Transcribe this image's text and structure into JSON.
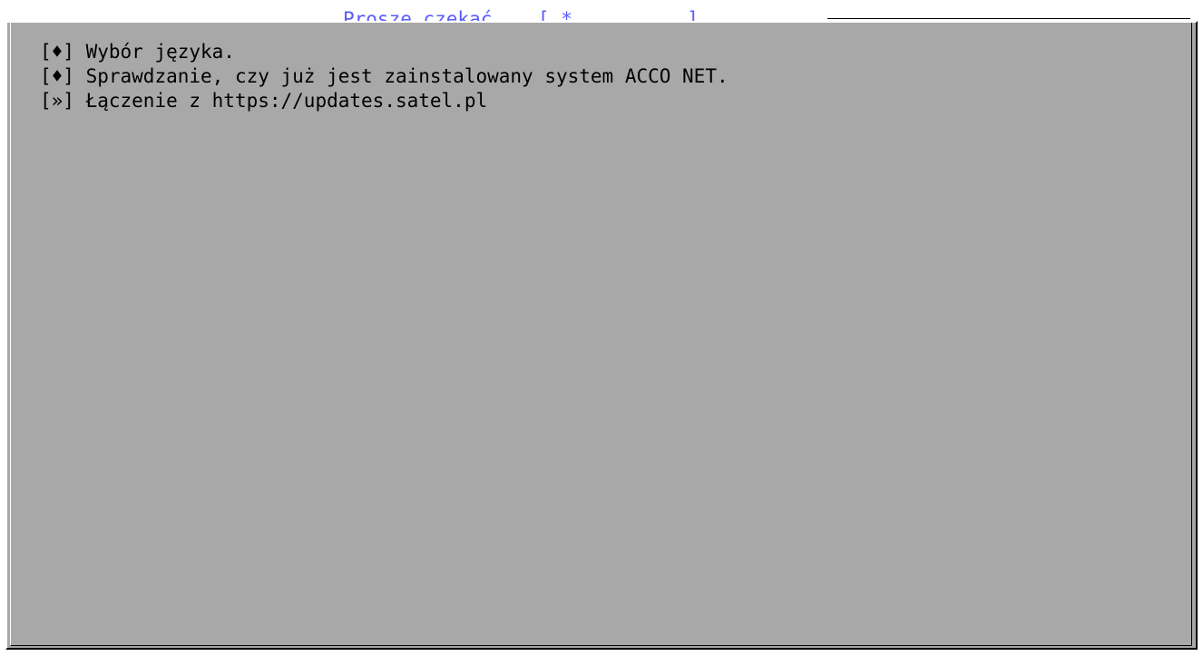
{
  "dialog": {
    "title": "Proszę czekać... [ *_________ ]"
  },
  "steps": [
    {
      "marker": "[♦]",
      "text": "Wybór języka."
    },
    {
      "marker": "[♦]",
      "text": "Sprawdzanie, czy już jest zainstalowany system ACCO NET."
    },
    {
      "marker": "[»]",
      "text": "Łączenie z https://updates.satel.pl"
    }
  ],
  "colors": {
    "background": "#a8a8a8",
    "title": "#5c5cff",
    "text": "#000000"
  }
}
